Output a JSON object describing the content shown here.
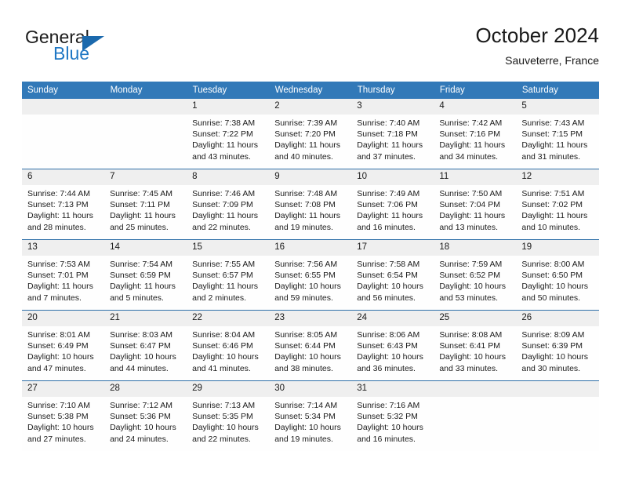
{
  "brand": {
    "name_part1": "General",
    "name_part2": "Blue",
    "flag_icon": "triangle-flag-icon"
  },
  "header": {
    "title": "October 2024",
    "subtitle": "Sauveterre, France"
  },
  "colors": {
    "header_blue": "#3279b8",
    "row_divider_blue": "#2f6fa8",
    "daynum_band": "#efefef",
    "brand_blue": "#1f77c4",
    "flag_blue": "#1b69ad"
  },
  "weekdays": [
    "Sunday",
    "Monday",
    "Tuesday",
    "Wednesday",
    "Thursday",
    "Friday",
    "Saturday"
  ],
  "weeks": [
    [
      {
        "day": "",
        "sunrise": "",
        "sunset": "",
        "daylight1": "",
        "daylight2": ""
      },
      {
        "day": "",
        "sunrise": "",
        "sunset": "",
        "daylight1": "",
        "daylight2": ""
      },
      {
        "day": "1",
        "sunrise": "Sunrise: 7:38 AM",
        "sunset": "Sunset: 7:22 PM",
        "daylight1": "Daylight: 11 hours",
        "daylight2": "and 43 minutes."
      },
      {
        "day": "2",
        "sunrise": "Sunrise: 7:39 AM",
        "sunset": "Sunset: 7:20 PM",
        "daylight1": "Daylight: 11 hours",
        "daylight2": "and 40 minutes."
      },
      {
        "day": "3",
        "sunrise": "Sunrise: 7:40 AM",
        "sunset": "Sunset: 7:18 PM",
        "daylight1": "Daylight: 11 hours",
        "daylight2": "and 37 minutes."
      },
      {
        "day": "4",
        "sunrise": "Sunrise: 7:42 AM",
        "sunset": "Sunset: 7:16 PM",
        "daylight1": "Daylight: 11 hours",
        "daylight2": "and 34 minutes."
      },
      {
        "day": "5",
        "sunrise": "Sunrise: 7:43 AM",
        "sunset": "Sunset: 7:15 PM",
        "daylight1": "Daylight: 11 hours",
        "daylight2": "and 31 minutes."
      }
    ],
    [
      {
        "day": "6",
        "sunrise": "Sunrise: 7:44 AM",
        "sunset": "Sunset: 7:13 PM",
        "daylight1": "Daylight: 11 hours",
        "daylight2": "and 28 minutes."
      },
      {
        "day": "7",
        "sunrise": "Sunrise: 7:45 AM",
        "sunset": "Sunset: 7:11 PM",
        "daylight1": "Daylight: 11 hours",
        "daylight2": "and 25 minutes."
      },
      {
        "day": "8",
        "sunrise": "Sunrise: 7:46 AM",
        "sunset": "Sunset: 7:09 PM",
        "daylight1": "Daylight: 11 hours",
        "daylight2": "and 22 minutes."
      },
      {
        "day": "9",
        "sunrise": "Sunrise: 7:48 AM",
        "sunset": "Sunset: 7:08 PM",
        "daylight1": "Daylight: 11 hours",
        "daylight2": "and 19 minutes."
      },
      {
        "day": "10",
        "sunrise": "Sunrise: 7:49 AM",
        "sunset": "Sunset: 7:06 PM",
        "daylight1": "Daylight: 11 hours",
        "daylight2": "and 16 minutes."
      },
      {
        "day": "11",
        "sunrise": "Sunrise: 7:50 AM",
        "sunset": "Sunset: 7:04 PM",
        "daylight1": "Daylight: 11 hours",
        "daylight2": "and 13 minutes."
      },
      {
        "day": "12",
        "sunrise": "Sunrise: 7:51 AM",
        "sunset": "Sunset: 7:02 PM",
        "daylight1": "Daylight: 11 hours",
        "daylight2": "and 10 minutes."
      }
    ],
    [
      {
        "day": "13",
        "sunrise": "Sunrise: 7:53 AM",
        "sunset": "Sunset: 7:01 PM",
        "daylight1": "Daylight: 11 hours",
        "daylight2": "and 7 minutes."
      },
      {
        "day": "14",
        "sunrise": "Sunrise: 7:54 AM",
        "sunset": "Sunset: 6:59 PM",
        "daylight1": "Daylight: 11 hours",
        "daylight2": "and 5 minutes."
      },
      {
        "day": "15",
        "sunrise": "Sunrise: 7:55 AM",
        "sunset": "Sunset: 6:57 PM",
        "daylight1": "Daylight: 11 hours",
        "daylight2": "and 2 minutes."
      },
      {
        "day": "16",
        "sunrise": "Sunrise: 7:56 AM",
        "sunset": "Sunset: 6:55 PM",
        "daylight1": "Daylight: 10 hours",
        "daylight2": "and 59 minutes."
      },
      {
        "day": "17",
        "sunrise": "Sunrise: 7:58 AM",
        "sunset": "Sunset: 6:54 PM",
        "daylight1": "Daylight: 10 hours",
        "daylight2": "and 56 minutes."
      },
      {
        "day": "18",
        "sunrise": "Sunrise: 7:59 AM",
        "sunset": "Sunset: 6:52 PM",
        "daylight1": "Daylight: 10 hours",
        "daylight2": "and 53 minutes."
      },
      {
        "day": "19",
        "sunrise": "Sunrise: 8:00 AM",
        "sunset": "Sunset: 6:50 PM",
        "daylight1": "Daylight: 10 hours",
        "daylight2": "and 50 minutes."
      }
    ],
    [
      {
        "day": "20",
        "sunrise": "Sunrise: 8:01 AM",
        "sunset": "Sunset: 6:49 PM",
        "daylight1": "Daylight: 10 hours",
        "daylight2": "and 47 minutes."
      },
      {
        "day": "21",
        "sunrise": "Sunrise: 8:03 AM",
        "sunset": "Sunset: 6:47 PM",
        "daylight1": "Daylight: 10 hours",
        "daylight2": "and 44 minutes."
      },
      {
        "day": "22",
        "sunrise": "Sunrise: 8:04 AM",
        "sunset": "Sunset: 6:46 PM",
        "daylight1": "Daylight: 10 hours",
        "daylight2": "and 41 minutes."
      },
      {
        "day": "23",
        "sunrise": "Sunrise: 8:05 AM",
        "sunset": "Sunset: 6:44 PM",
        "daylight1": "Daylight: 10 hours",
        "daylight2": "and 38 minutes."
      },
      {
        "day": "24",
        "sunrise": "Sunrise: 8:06 AM",
        "sunset": "Sunset: 6:43 PM",
        "daylight1": "Daylight: 10 hours",
        "daylight2": "and 36 minutes."
      },
      {
        "day": "25",
        "sunrise": "Sunrise: 8:08 AM",
        "sunset": "Sunset: 6:41 PM",
        "daylight1": "Daylight: 10 hours",
        "daylight2": "and 33 minutes."
      },
      {
        "day": "26",
        "sunrise": "Sunrise: 8:09 AM",
        "sunset": "Sunset: 6:39 PM",
        "daylight1": "Daylight: 10 hours",
        "daylight2": "and 30 minutes."
      }
    ],
    [
      {
        "day": "27",
        "sunrise": "Sunrise: 7:10 AM",
        "sunset": "Sunset: 5:38 PM",
        "daylight1": "Daylight: 10 hours",
        "daylight2": "and 27 minutes."
      },
      {
        "day": "28",
        "sunrise": "Sunrise: 7:12 AM",
        "sunset": "Sunset: 5:36 PM",
        "daylight1": "Daylight: 10 hours",
        "daylight2": "and 24 minutes."
      },
      {
        "day": "29",
        "sunrise": "Sunrise: 7:13 AM",
        "sunset": "Sunset: 5:35 PM",
        "daylight1": "Daylight: 10 hours",
        "daylight2": "and 22 minutes."
      },
      {
        "day": "30",
        "sunrise": "Sunrise: 7:14 AM",
        "sunset": "Sunset: 5:34 PM",
        "daylight1": "Daylight: 10 hours",
        "daylight2": "and 19 minutes."
      },
      {
        "day": "31",
        "sunrise": "Sunrise: 7:16 AM",
        "sunset": "Sunset: 5:32 PM",
        "daylight1": "Daylight: 10 hours",
        "daylight2": "and 16 minutes."
      },
      {
        "day": "",
        "sunrise": "",
        "sunset": "",
        "daylight1": "",
        "daylight2": ""
      },
      {
        "day": "",
        "sunrise": "",
        "sunset": "",
        "daylight1": "",
        "daylight2": ""
      }
    ]
  ]
}
